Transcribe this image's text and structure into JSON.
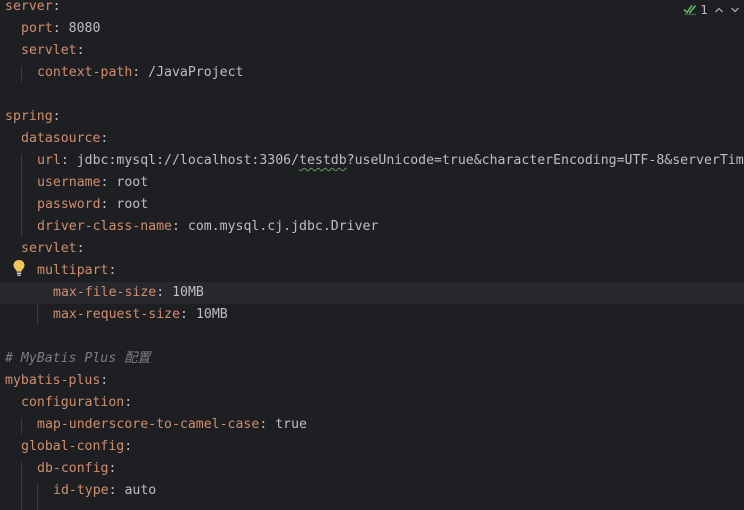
{
  "inspection_widget": {
    "count": "1",
    "check_icon": "double-check-icon",
    "up_icon": "chevron-up-icon",
    "down_icon": "chevron-down-icon"
  },
  "editor": {
    "current_line_index": 13,
    "lines": [
      {
        "key": "server",
        "sep": ":",
        "value": ""
      },
      {
        "key": "port",
        "sep": ": ",
        "value": "8080"
      },
      {
        "key": "servlet",
        "sep": ":",
        "value": ""
      },
      {
        "key": "context-path",
        "sep": ": ",
        "value": "/JavaProject"
      },
      {
        "key": "",
        "sep": "",
        "value": ""
      },
      {
        "key": "spring",
        "sep": ":",
        "value": ""
      },
      {
        "key": "datasource",
        "sep": ":",
        "value": ""
      },
      {
        "key": "url",
        "sep": ": ",
        "value_parts": [
          "jdbc:mysql://localhost:3306/",
          "testdb",
          "?useUnicode=true&characterEncoding=UTF-8&serverTim"
        ]
      },
      {
        "key": "username",
        "sep": ": ",
        "value": "root"
      },
      {
        "key": "password",
        "sep": ": ",
        "value": "root"
      },
      {
        "key": "driver-class-name",
        "sep": ": ",
        "value": "com.mysql.cj.jdbc.Driver"
      },
      {
        "key": "servlet",
        "sep": ":",
        "value": ""
      },
      {
        "key": "multipart",
        "sep": ":",
        "value": ""
      },
      {
        "key": "max-file-size",
        "sep": ": ",
        "value": "10MB"
      },
      {
        "key": "max-request-size",
        "sep": ": ",
        "value": "10MB"
      },
      {
        "key": "",
        "sep": "",
        "value": ""
      },
      {
        "comment": "# MyBatis Plus 配置"
      },
      {
        "key": "mybatis-plus",
        "sep": ":",
        "value": ""
      },
      {
        "key": "configuration",
        "sep": ":",
        "value": ""
      },
      {
        "key": "map-underscore-to-camel-case",
        "sep": ": ",
        "value": "true"
      },
      {
        "key": "global-config",
        "sep": ":",
        "value": ""
      },
      {
        "key": "db-config",
        "sep": ":",
        "value": ""
      },
      {
        "key": "id-type",
        "sep": ": ",
        "value": "auto"
      }
    ]
  },
  "intention_icon": "lightbulb-icon",
  "colors": {
    "background": "#1e1f22",
    "key": "#cf8e6d",
    "value": "#bcbec4",
    "comment": "#7a7e85",
    "current_line": "#26282e",
    "indent_guide": "#393b40",
    "check": "#5fb865",
    "bulb": "#f2c55c"
  }
}
